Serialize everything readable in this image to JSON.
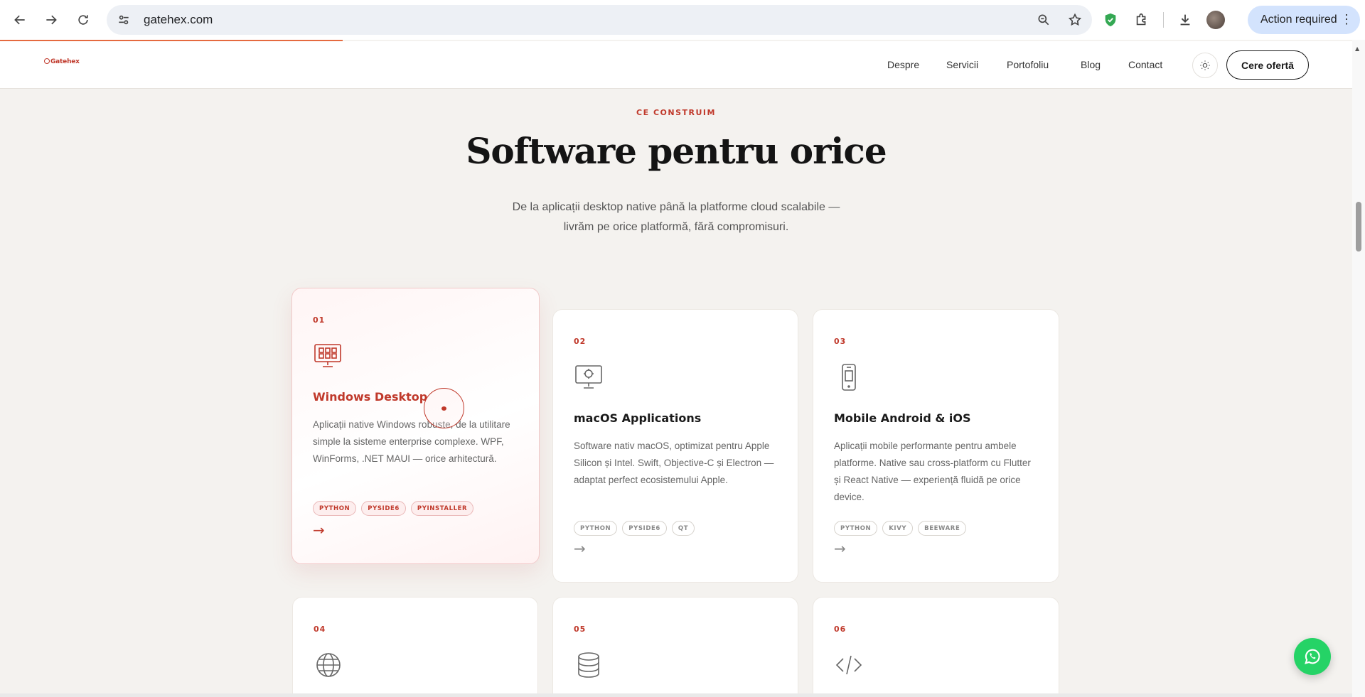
{
  "browser": {
    "url": "gatehex.com",
    "action_required": "Action required",
    "icons": [
      "back-icon",
      "forward-icon",
      "reload-icon",
      "site-settings-icon",
      "zoom-icon",
      "bookmark-star-icon",
      "shield-extension-icon",
      "extensions-puzzle-icon",
      "download-icon",
      "profile-avatar",
      "more-menu-icon"
    ]
  },
  "site": {
    "logo_text": "Gatehex",
    "nav": [
      {
        "label": "Despre"
      },
      {
        "label": "Servicii"
      },
      {
        "label": "Portofoliu"
      },
      {
        "label": "Blog"
      },
      {
        "label": "Contact"
      }
    ],
    "cta": "Cere ofertă",
    "scroll_progress": 0.25
  },
  "section": {
    "eyebrow": "CE CONSTRUIM",
    "headline": "Software pentru orice",
    "subtitle_line1": "De la aplicații desktop native până la platforme cloud scalabile —",
    "subtitle_line2": "livrăm pe orice platformă, fără compromisuri."
  },
  "cards": [
    {
      "num": "01",
      "icon": "desktop-grid-icon",
      "title": "Windows Desktop",
      "desc": "Aplicații native Windows robuste, de la utilitare simple la sisteme enterprise complexe. WPF, WinForms, .NET MAUI — orice arhitectură.",
      "tags": [
        "PYTHON",
        "PYSIDE6",
        "PYINSTALLER"
      ],
      "arrow": "→",
      "active": true
    },
    {
      "num": "02",
      "icon": "monitor-icon",
      "title": "macOS Applications",
      "desc": "Software nativ macOS, optimizat pentru Apple Silicon și Intel. Swift, Objective-C și Electron — adaptat perfect ecosistemului Apple.",
      "tags": [
        "PYTHON",
        "PYSIDE6",
        "QT"
      ],
      "arrow": "→",
      "active": false
    },
    {
      "num": "03",
      "icon": "smartphone-icon",
      "title": "Mobile Android & iOS",
      "desc": "Aplicații mobile performante pentru ambele platforme. Native sau cross-platform cu Flutter și React Native — experiență fluidă pe orice device.",
      "tags": [
        "PYTHON",
        "KIVY",
        "BEEWARE"
      ],
      "arrow": "→",
      "active": false
    },
    {
      "num": "04",
      "icon": "globe-icon"
    },
    {
      "num": "05",
      "icon": "database-icon"
    },
    {
      "num": "06",
      "icon": "code-icon"
    }
  ],
  "colors": {
    "accent": "#c0392b",
    "page_bg": "#f4f2ef",
    "whatsapp": "#25d366",
    "action_chip": "#d3e3fd"
  }
}
